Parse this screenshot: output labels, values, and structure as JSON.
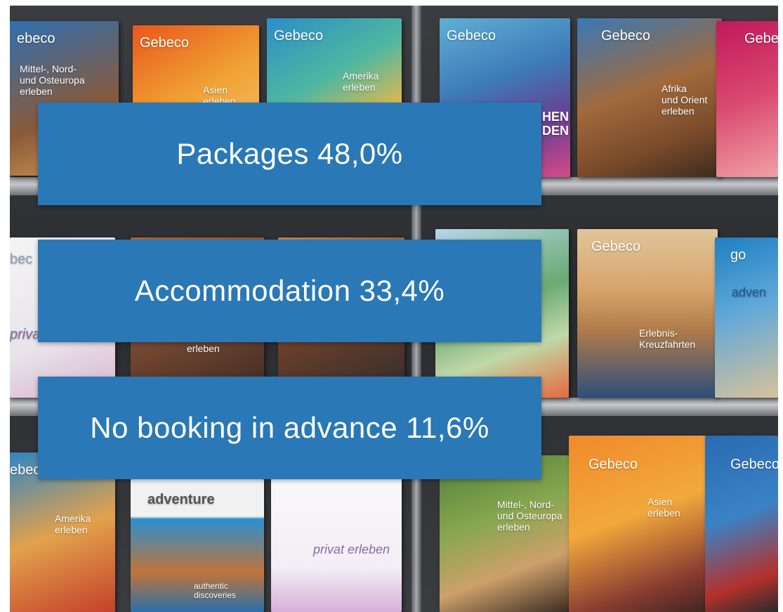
{
  "bands": [
    {
      "text": "Packages 48,0%"
    },
    {
      "text": "Accommodation 33,4%"
    },
    {
      "text": "No booking in advance 11,6%"
    }
  ],
  "brochures": [
    {
      "brand": "ebeco",
      "sub": "Mittel-, Nord-\nund Osteuropa\nerleben"
    },
    {
      "brand": "Gebeco",
      "sub": "Asien\nerleben"
    },
    {
      "brand": "Gebeco",
      "sub": "Amerika\nerleben"
    },
    {
      "brand": "Gebeco",
      "sub": "HEN\nDEN"
    },
    {
      "brand": "Gebeco",
      "sub": "Afrika\nund Orient\nerleben"
    },
    {
      "brand": "Gebe",
      "sub": ""
    },
    {
      "brand": "bec",
      "sub": "priva"
    },
    {
      "brand": "",
      "sub": "erleben"
    },
    {
      "brand": "Gebeco",
      "sub": "Erlebnis-\nKreuzfahrten"
    },
    {
      "brand": "go",
      "sub": "adven"
    },
    {
      "brand": "ebec",
      "sub": "Amerika\nerleben"
    },
    {
      "brand": "adventure",
      "sub": "authentic\ndiscoveries"
    },
    {
      "brand": "",
      "sub": "privat erleben"
    },
    {
      "brand": "",
      "sub": "Mittel-, Nord-\nund Osteuropa\nerleben"
    },
    {
      "brand": "Gebeco",
      "sub": "Asien\nerleben"
    },
    {
      "brand": "Gebeco",
      "sub": ""
    }
  ],
  "colors": {
    "band": "#2a78b6",
    "band_text": "#ffffff",
    "page": "#ffffff"
  }
}
